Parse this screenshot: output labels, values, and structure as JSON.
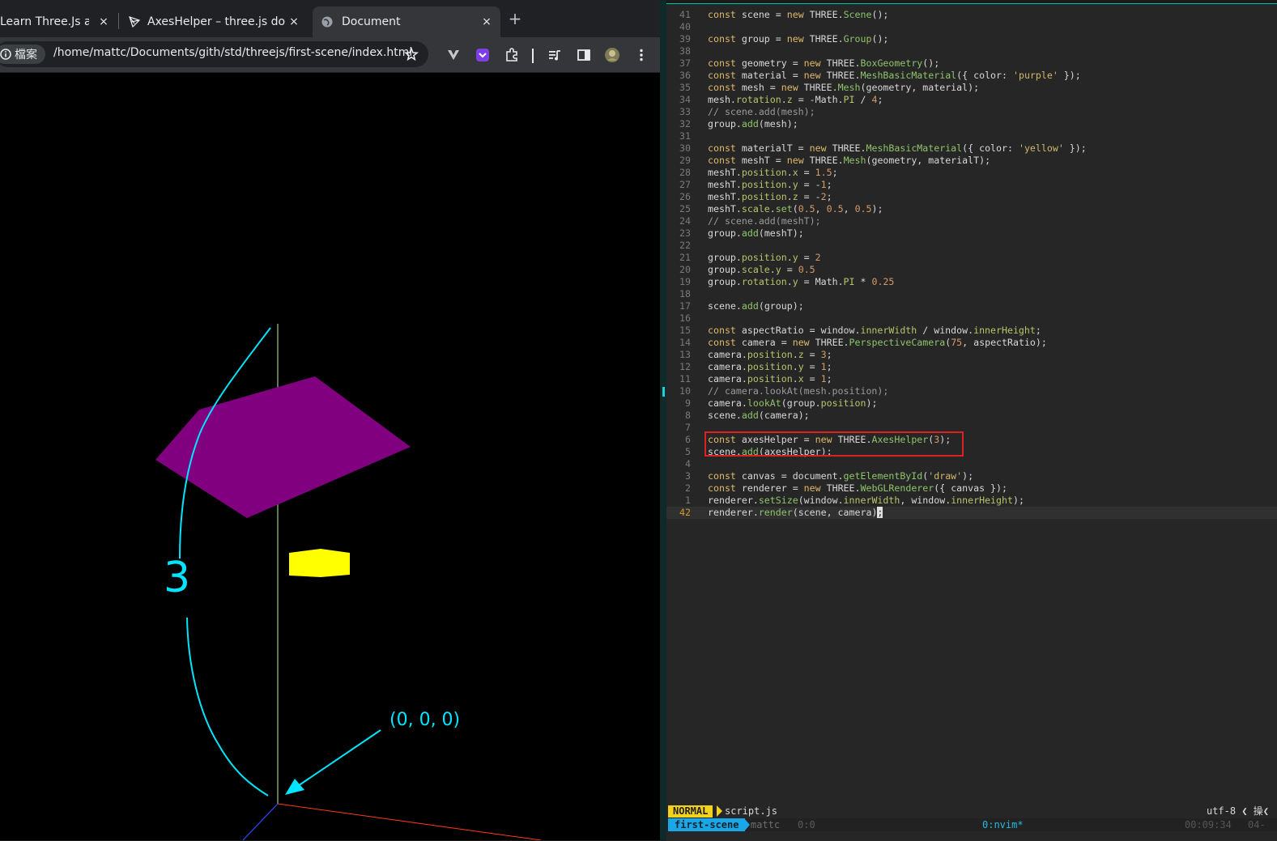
{
  "browser": {
    "tabs": [
      {
        "title": "Learn Three.Js a",
        "close": "×",
        "icon": "none"
      },
      {
        "title": "AxesHelper – three.js do",
        "close": "×",
        "icon": "three-js-logo-icon"
      },
      {
        "title": "Document",
        "close": "×",
        "icon": "globe-icon",
        "active": true
      }
    ],
    "new_tab": "+",
    "address_chip": "檔案",
    "url": "/home/mattc/Documents/gith/std/threejs/first-scene/index.html",
    "toolbar_icons": [
      "star-icon",
      "extension-v-icon",
      "extension-purple-icon",
      "puzzle-icon",
      "media-icon",
      "sidepanel-icon",
      "avatar",
      "menu-icon"
    ]
  },
  "scene": {
    "annotation_number": "3",
    "origin_label": "(0, 0, 0)",
    "colors": {
      "purple_plane": "#800080",
      "yellow_box": "#ffff00",
      "annotation": "#00e5ff",
      "y_axis": "#b8f59a",
      "x_axis": "#ff3a1a",
      "z_axis": "#2a4bff"
    }
  },
  "editor": {
    "lines": [
      {
        "n": "41",
        "code": "const scene = new THREE.Scene();"
      },
      {
        "n": "40",
        "code": ""
      },
      {
        "n": "39",
        "code": "const group = new THREE.Group();"
      },
      {
        "n": "38",
        "code": ""
      },
      {
        "n": "37",
        "code": "const geometry = new THREE.BoxGeometry();"
      },
      {
        "n": "36",
        "code": "const material = new THREE.MeshBasicMaterial({ color: 'purple' });"
      },
      {
        "n": "35",
        "code": "const mesh = new THREE.Mesh(geometry, material);"
      },
      {
        "n": "34",
        "code": "mesh.rotation.z = -Math.PI / 4;"
      },
      {
        "n": "33",
        "code": "// scene.add(mesh);"
      },
      {
        "n": "32",
        "code": "group.add(mesh);"
      },
      {
        "n": "31",
        "code": ""
      },
      {
        "n": "30",
        "code": "const materialT = new THREE.MeshBasicMaterial({ color: 'yellow' });"
      },
      {
        "n": "29",
        "code": "const meshT = new THREE.Mesh(geometry, materialT);"
      },
      {
        "n": "28",
        "code": "meshT.position.x = 1.5;"
      },
      {
        "n": "27",
        "code": "meshT.position.y = -1;"
      },
      {
        "n": "26",
        "code": "meshT.position.z = -2;"
      },
      {
        "n": "25",
        "code": "meshT.scale.set(0.5, 0.5, 0.5);"
      },
      {
        "n": "24",
        "code": "// scene.add(meshT);"
      },
      {
        "n": "23",
        "code": "group.add(meshT);"
      },
      {
        "n": "22",
        "code": ""
      },
      {
        "n": "21",
        "code": "group.position.y = 2"
      },
      {
        "n": "20",
        "code": "group.scale.y = 0.5"
      },
      {
        "n": "19",
        "code": "group.rotation.y = Math.PI * 0.25"
      },
      {
        "n": "18",
        "code": ""
      },
      {
        "n": "17",
        "code": "scene.add(group);"
      },
      {
        "n": "16",
        "code": ""
      },
      {
        "n": "15",
        "code": "const aspectRatio = window.innerWidth / window.innerHeight;"
      },
      {
        "n": "14",
        "code": "const camera = new THREE.PerspectiveCamera(75, aspectRatio);"
      },
      {
        "n": "13",
        "code": "camera.position.z = 3;"
      },
      {
        "n": "12",
        "code": "camera.position.y = 1;"
      },
      {
        "n": "11",
        "code": "camera.position.x = 1;"
      },
      {
        "n": "10",
        "code": "// camera.lookAt(mesh.position);"
      },
      {
        "n": "9",
        "code": "camera.lookAt(group.position);"
      },
      {
        "n": "8",
        "code": "scene.add(camera);"
      },
      {
        "n": "7",
        "code": ""
      },
      {
        "n": "6",
        "code": "const axesHelper = new THREE.AxesHelper(3);"
      },
      {
        "n": "5",
        "code": "scene.add(axesHelper);"
      },
      {
        "n": "4",
        "code": ""
      },
      {
        "n": "3",
        "code": "const canvas = document.getElementById('draw');"
      },
      {
        "n": "2",
        "code": "const renderer = new THREE.WebGLRenderer({ canvas });"
      },
      {
        "n": "1",
        "code": "renderer.setSize(window.innerWidth, window.innerHeight);"
      },
      {
        "n": "42",
        "code": "renderer.render(scene, camera);",
        "current": true
      }
    ],
    "status": {
      "mode": "NORMAL",
      "file": "script.js",
      "encoding": "utf-8 ❮ 操❮"
    },
    "tmux": {
      "session": "first-scene",
      "user": "mattc",
      "pane": "0:0",
      "window": "0:nvim*",
      "time": "00:09:34",
      "date": "04-"
    }
  }
}
